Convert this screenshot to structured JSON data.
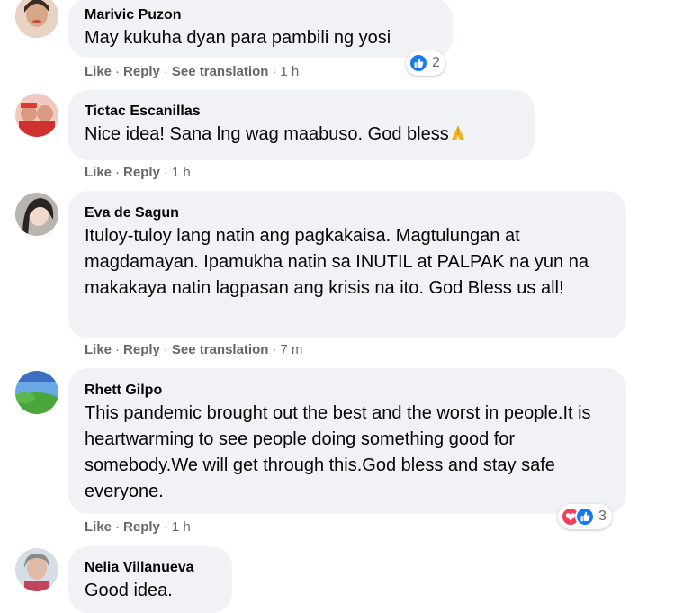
{
  "colors": {
    "bubble": "#f0f2f5",
    "meta_text": "#65676b",
    "like_blue": "#1877f2",
    "love_red": "#f33e58"
  },
  "action_labels": {
    "like": "Like",
    "reply": "Reply",
    "see_translation": "See translation",
    "separator": "·"
  },
  "comments": [
    {
      "author": "Marivic Puzon",
      "text": "May kukuha dyan para pambili ng yosi",
      "time": "1 h",
      "has_translation": true,
      "reactions": {
        "icons": [
          "like-icon"
        ],
        "count": "2"
      }
    },
    {
      "author": "Tictac Escanillas",
      "text": "Nice idea! Sana lng wag maabuso. God bless",
      "emoji": "folded-hands-icon",
      "time": "1 h",
      "has_translation": false
    },
    {
      "author": "Eva de Sagun",
      "text": "Ituloy-tuloy lang natin ang pagkakaisa. Magtulungan at magdamayan. Ipamukha natin sa INUTIL at PALPAK na yun na makakaya natin lagpasan ang krisis na ito. God Bless us all!",
      "time": "7 m",
      "has_translation": true
    },
    {
      "author": "Rhett Gilpo",
      "text": "This pandemic brought out the best and the worst in people.It is heartwarming to see people doing something good for somebody.We will get through this.God bless and stay safe everyone.",
      "time": "1 h",
      "has_translation": false,
      "reactions": {
        "icons": [
          "love-icon",
          "like-icon"
        ],
        "count": "3"
      }
    },
    {
      "author": "Nelia Villanueva",
      "text": "Good idea."
    }
  ]
}
